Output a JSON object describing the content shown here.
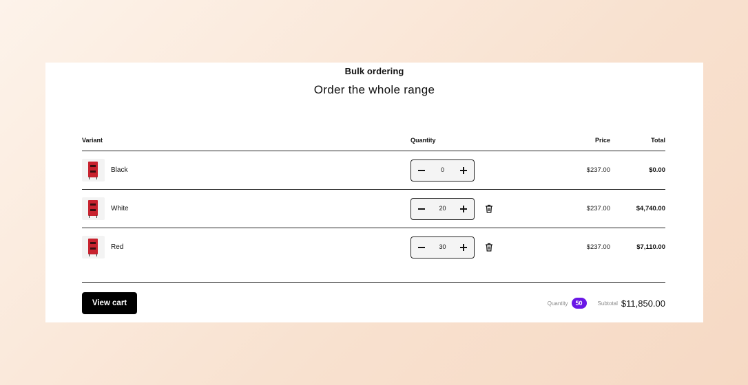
{
  "header": {
    "eyebrow": "Bulk ordering",
    "title": "Order the whole range"
  },
  "table": {
    "headers": {
      "variant": "Variant",
      "quantity": "Quantity",
      "price": "Price",
      "total": "Total"
    },
    "rows": [
      {
        "name": "Black",
        "quantity": "0",
        "price": "$237.00",
        "total": "$0.00",
        "removable": false
      },
      {
        "name": "White",
        "quantity": "20",
        "price": "$237.00",
        "total": "$4,740.00",
        "removable": true
      },
      {
        "name": "Red",
        "quantity": "30",
        "price": "$237.00",
        "total": "$7,110.00",
        "removable": true
      }
    ]
  },
  "footer": {
    "view_cart_label": "View cart",
    "quantity_label": "Quantity",
    "quantity_count": "50",
    "subtotal_label": "Subtotal",
    "subtotal_value": "$11,850.00"
  },
  "colors": {
    "badge": "#6a17e6",
    "product": "#c8222e",
    "button": "#000000"
  },
  "icons": [
    "minus-icon",
    "plus-icon",
    "trash-icon"
  ]
}
